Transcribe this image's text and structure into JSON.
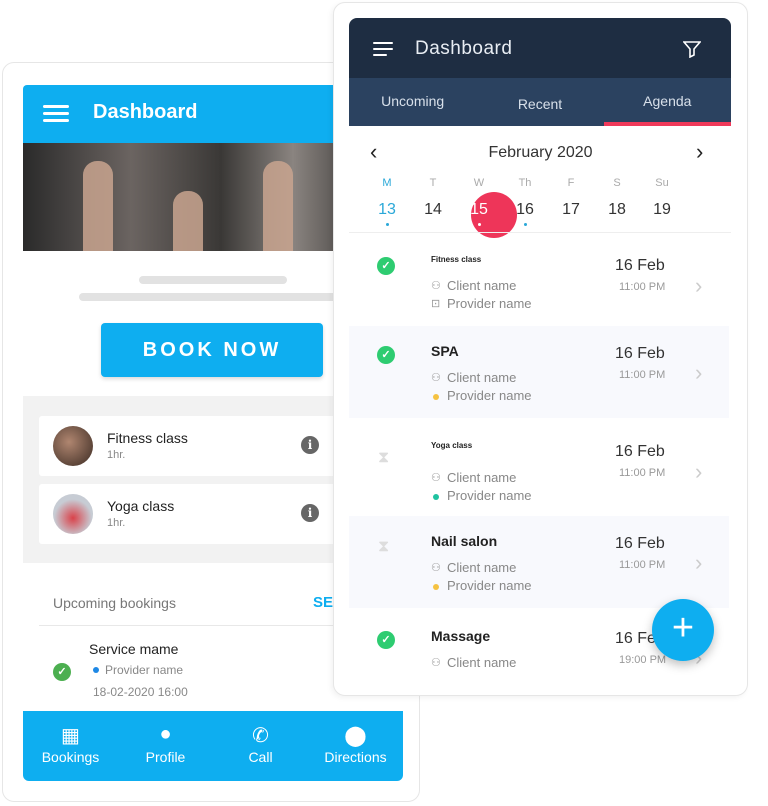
{
  "left": {
    "header": {
      "title": "Dashboard",
      "menu_icon": "hamburger-icon"
    },
    "book_now": "BOOK NOW",
    "services": [
      {
        "name": "Fitness class",
        "duration": "1hr."
      },
      {
        "name": "Yoga class",
        "duration": "1hr."
      }
    ],
    "upcoming": {
      "label": "Upcoming bookings",
      "see_all": "SE"
    },
    "booking": {
      "service": "Service mame",
      "provider": "Provider name",
      "datetime": "18-02-2020 16:00"
    },
    "nav": [
      {
        "label": "Bookings",
        "icon": "calendar-icon"
      },
      {
        "label": "Profile",
        "icon": "person-icon"
      },
      {
        "label": "Call",
        "icon": "phone-icon"
      },
      {
        "label": "Directions",
        "icon": "location-pin-icon"
      }
    ],
    "colors": {
      "primary": "#0eaef0"
    }
  },
  "right": {
    "header": {
      "title": "Dashboard",
      "filter_icon": "filter-icon"
    },
    "tabs": [
      "Uncoming",
      "Recent",
      "Agenda"
    ],
    "active_tab": "Agenda",
    "month": "February 2020",
    "weekdays": [
      "M",
      "T",
      "W",
      "Th",
      "F",
      "S",
      "Su"
    ],
    "days": [
      "13",
      "14",
      "15",
      "16",
      "17",
      "18",
      "19"
    ],
    "selected_day": "15",
    "agenda": [
      {
        "title": "Fitness class",
        "client": "Client name",
        "provider": "Provider name",
        "date": "16 Feb",
        "time": "11:00 PM",
        "status": "confirmed"
      },
      {
        "title": "SPA",
        "client": "Client name",
        "provider": "Provider name",
        "date": "16 Feb",
        "time": "11:00 PM",
        "status": "confirmed",
        "dot": "#f5c242"
      },
      {
        "title": "Yoga class",
        "client": "Client name",
        "provider": "Provider name",
        "date": "16 Feb",
        "time": "11:00 PM",
        "status": "pending",
        "dot": "#1fc2a0"
      },
      {
        "title": "Nail salon",
        "client": "Client name",
        "provider": "Provider name",
        "date": "16 Feb",
        "time": "11:00 PM",
        "status": "pending",
        "dot": "#f5c242"
      },
      {
        "title": "Massage",
        "client": "Client name",
        "date": "16 Feb",
        "time": "19:00 PM",
        "status": "confirmed"
      }
    ],
    "colors": {
      "header": "#1e2d42",
      "tabs": "#2b4260",
      "accent": "#ee3559",
      "fab": "#0eaef0"
    }
  }
}
